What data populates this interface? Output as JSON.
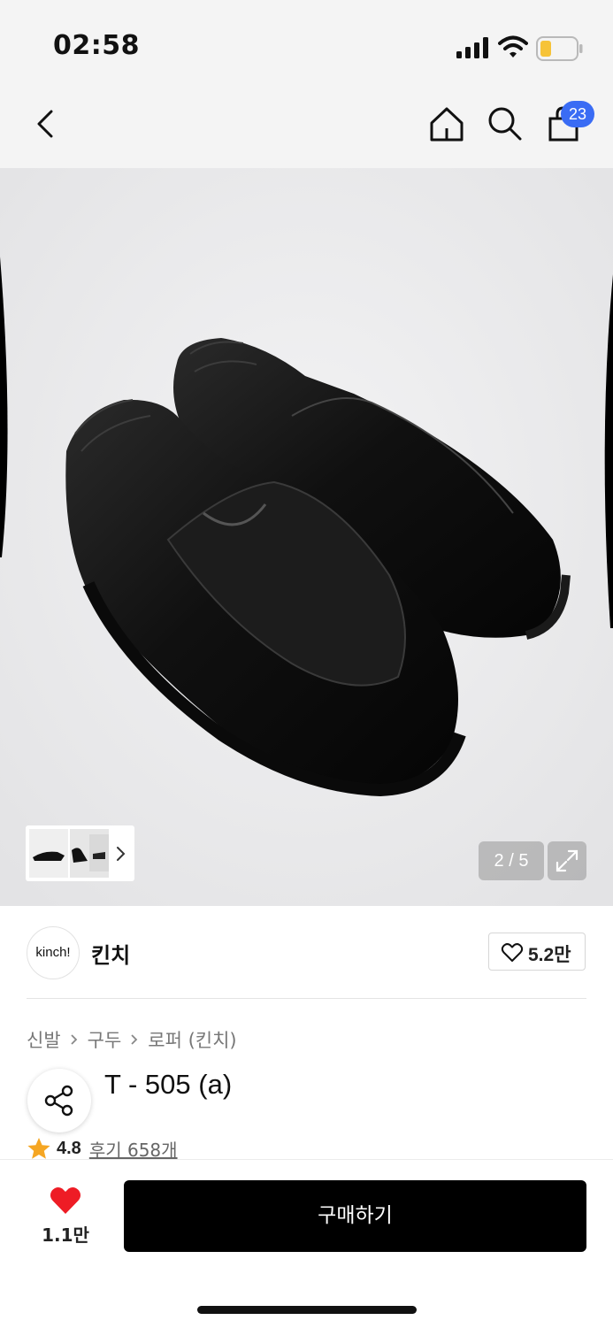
{
  "status_bar": {
    "time": "02:58"
  },
  "header": {
    "cart_badge": "23"
  },
  "gallery": {
    "counter": "2 / 5"
  },
  "brand": {
    "logo_text": "kinch!",
    "name": "킨치",
    "like_count": "5.2만"
  },
  "breadcrumb": [
    "신발",
    "구두",
    "로퍼 (킨치)"
  ],
  "product": {
    "title_visible": "T - 505 (a)",
    "rating": "4.8",
    "reviews": "후기 658개"
  },
  "bottom_bar": {
    "wish_count": "1.1만",
    "buy_label": "구매하기"
  },
  "colors": {
    "badge": "#3a6cf4",
    "heart": "#ee1c25",
    "star": "#f5a623",
    "buy_button": "#000000"
  }
}
